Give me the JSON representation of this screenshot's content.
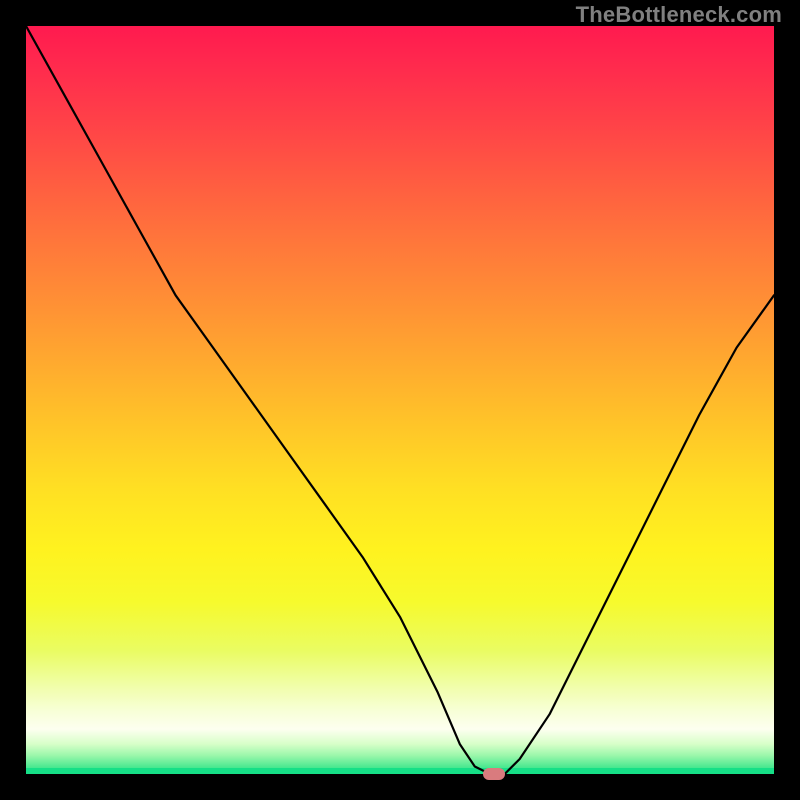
{
  "watermark": "TheBottleneck.com",
  "chart_data": {
    "type": "line",
    "title": "",
    "xlabel": "",
    "ylabel": "",
    "xlim": [
      0,
      100
    ],
    "ylim": [
      0,
      100
    ],
    "grid": false,
    "legend": false,
    "background": "rainbow-gradient (red→orange→yellow→green vertical)",
    "annotations": [
      {
        "text": "TheBottleneck.com",
        "position": "top-right",
        "color": "#808080"
      }
    ],
    "marker": {
      "x": 62.5,
      "y": 0,
      "shape": "rounded-rect",
      "color": "#d97b7e"
    },
    "series": [
      {
        "name": "bottleneck-curve",
        "color": "#000000",
        "x": [
          0,
          5,
          10,
          15,
          20,
          25,
          30,
          35,
          40,
          45,
          50,
          55,
          58,
          60,
          62,
          64,
          66,
          70,
          75,
          80,
          85,
          90,
          95,
          100
        ],
        "y": [
          100,
          91,
          82,
          73,
          64,
          57,
          50,
          43,
          36,
          29,
          21,
          11,
          4,
          1,
          0,
          0,
          2,
          8,
          18,
          28,
          38,
          48,
          57,
          64
        ]
      }
    ],
    "optimum_x": 62.5
  },
  "colors": {
    "background_black": "#000000",
    "watermark_gray": "#808080",
    "curve": "#000000",
    "marker": "#d97b7e",
    "gradient_top": "#ff1a4f",
    "gradient_bottom": "#16df87"
  }
}
